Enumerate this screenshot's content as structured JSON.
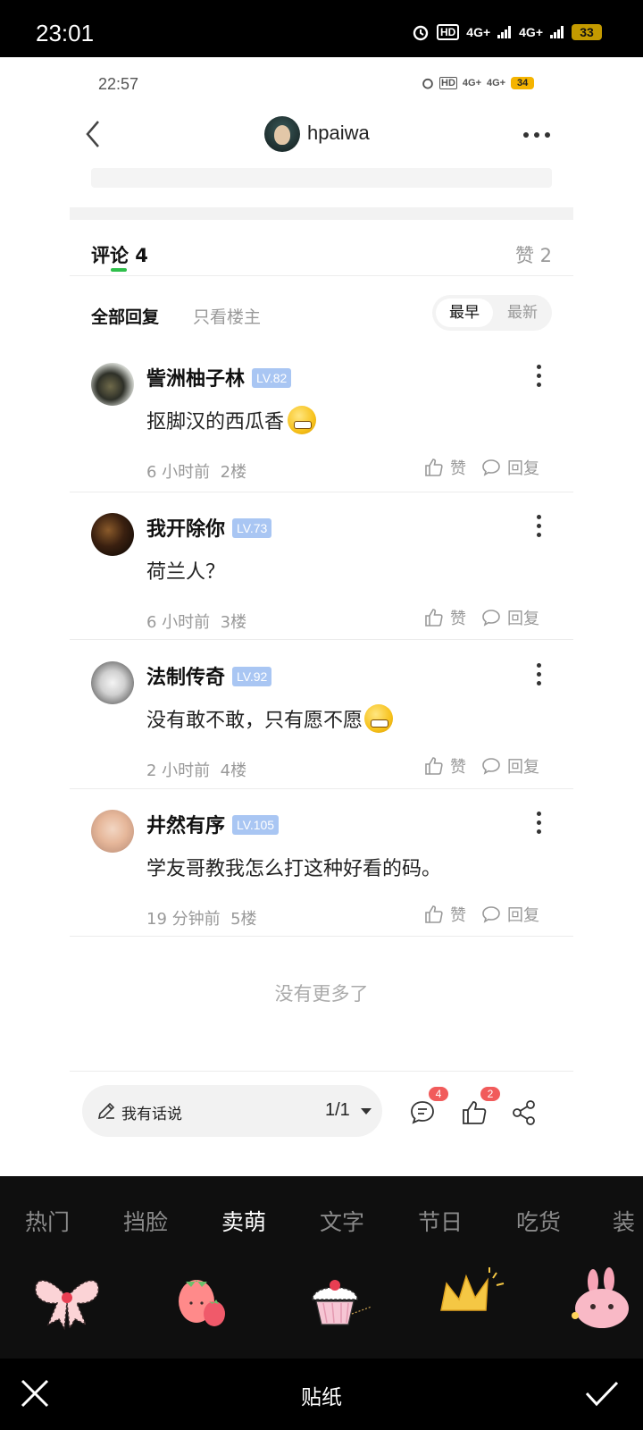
{
  "outer_status": {
    "time": "23:01",
    "signal_1": "4G+",
    "signal_2": "4G+",
    "hd": "HD",
    "battery": "33"
  },
  "inner_status": {
    "time": "22:57",
    "signal_1": "4G+",
    "signal_2": "4G+",
    "hd": "HD",
    "battery": "34"
  },
  "header": {
    "username": "hpaiwa"
  },
  "comments_header": {
    "title": "评论 4",
    "likes": "赞 2"
  },
  "filters": {
    "all": "全部回复",
    "host_only": "只看楼主",
    "sort_earliest": "最早",
    "sort_latest": "最新"
  },
  "comments": [
    {
      "name": "訾洲柚子林",
      "level": "LV.82",
      "text": "抠脚汉的西瓜香",
      "has_emoji": true,
      "time": "6 小时前",
      "floor": "2楼",
      "like_label": "赞",
      "reply_label": "回复"
    },
    {
      "name": "我开除你",
      "level": "LV.73",
      "text": "荷兰人？",
      "has_emoji": false,
      "time": "6 小时前",
      "floor": "3楼",
      "like_label": "赞",
      "reply_label": "回复"
    },
    {
      "name": "法制传奇",
      "level": "LV.92",
      "text": "没有敢不敢，只有愿不愿",
      "has_emoji": true,
      "time": "2 小时前",
      "floor": "4楼",
      "like_label": "赞",
      "reply_label": "回复"
    },
    {
      "name": "井然有序",
      "level": "LV.105",
      "text": "学友哥教我怎么打这种好看的码。",
      "has_emoji": false,
      "time": "19 分钟前",
      "floor": "5楼",
      "like_label": "赞",
      "reply_label": "回复"
    }
  ],
  "no_more": "没有更多了",
  "input_bar": {
    "placeholder": "我有话说",
    "page": "1/1",
    "comment_badge": "4",
    "like_badge": "2"
  },
  "sticker_panel": {
    "categories": [
      "热门",
      "挡脸",
      "卖萌",
      "文字",
      "节日",
      "吃货",
      "装"
    ],
    "active_category": "卖萌",
    "stickers": [
      "bow-sticker",
      "strawberry-sticker",
      "cupcake-sticker",
      "crown-sticker",
      "bunny-sticker"
    ]
  },
  "bottom_bar": {
    "title": "贴纸"
  },
  "colors": {
    "accent_green": "#2fbf4b",
    "badge_red": "#f15b5b",
    "level_blue": "#a9c6f3"
  }
}
